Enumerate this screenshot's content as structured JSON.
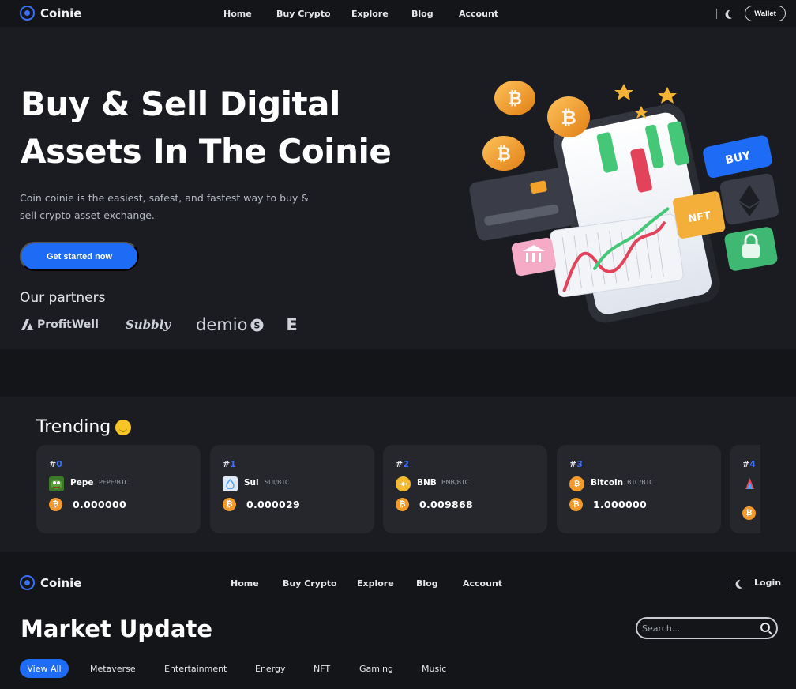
{
  "brand": {
    "name": "Coinie"
  },
  "top_nav": {
    "menu": [
      "Home",
      "Buy Crypto",
      "Explore",
      "Blog",
      "Account"
    ],
    "wallet_label": "Wallet"
  },
  "hero": {
    "title_line1": "Buy & Sell Digital",
    "title_line2": "Assets In The Coinie",
    "description": "Coin coinie is the easiest, safest, and fastest way to buy & sell crypto asset exchange.",
    "cta_label": "Get started now",
    "partners_title": "Our partners",
    "partners": [
      "ProfitWell",
      "Subbly",
      "demio",
      "E"
    ],
    "illustration": {
      "buy_label": "BUY",
      "nft_label": "NFT"
    }
  },
  "trending": {
    "title": "Trending",
    "cards": [
      {
        "rank_prefix": "#",
        "rank": "0",
        "name": "Pepe",
        "pair": "PEPE/BTC",
        "price": "0.000000",
        "icon": "pepe-icon",
        "color": "#3d7a2a"
      },
      {
        "rank_prefix": "#",
        "rank": "1",
        "name": "Sui",
        "pair": "SUI/BTC",
        "price": "0.000029",
        "icon": "sui-icon",
        "color": "#dfe9f7"
      },
      {
        "rank_prefix": "#",
        "rank": "2",
        "name": "BNB",
        "pair": "BNB/BTC",
        "price": "0.009868",
        "icon": "bnb-icon",
        "color": "#f3ba2f"
      },
      {
        "rank_prefix": "#",
        "rank": "3",
        "name": "Bitcoin",
        "pair": "BTC/BTC",
        "price": "1.000000",
        "icon": "bitcoin-icon",
        "color": "#f39a2b"
      },
      {
        "rank_prefix": "#",
        "rank": "4",
        "name": "",
        "pair": "",
        "price": "",
        "icon": "coin-icon",
        "color": "#e14b5a"
      }
    ]
  },
  "second_nav": {
    "menu": [
      "Home",
      "Buy Crypto",
      "Explore",
      "Blog",
      "Account"
    ],
    "login_label": "Login"
  },
  "market": {
    "title": "Market Update",
    "search_placeholder": "Search...",
    "filters": [
      "View All",
      "Metaverse",
      "Entertainment",
      "Energy",
      "NFT",
      "Gaming",
      "Music"
    ],
    "active_filter": "View All"
  },
  "colors": {
    "accent": "#1e6bf5",
    "background": "#141519",
    "surface": "#1b1c21",
    "card": "#25272d",
    "bitcoin": "#f39a2b"
  }
}
